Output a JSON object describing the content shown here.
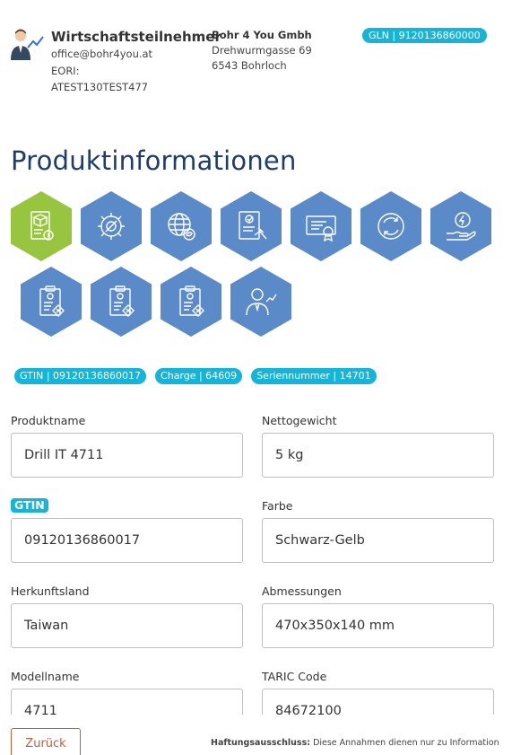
{
  "header": {
    "company_name": "Wirtschaftsteilnehmer",
    "email": "office@bohr4you.at",
    "eori_label": "EORI:",
    "eori_value": "ATEST130TEST477",
    "address_name": "Bohr 4 You Gmbh",
    "address_street": "Drehwurmgasse 69",
    "address_city": "6543 Bohrloch",
    "gln_badge": "GLN | 9120136860000"
  },
  "page_title": "Produktinformationen",
  "category_icons": [
    "product-box-icon",
    "settings-tools-icon",
    "globe-leaf-icon",
    "checklist-gavel-icon",
    "certificate-icon",
    "recycle-icon",
    "hand-energy-icon",
    "clipboard-hazard-icon",
    "clipboard-hazard-icon",
    "clipboard-hazard-icon",
    "person-chart-icon"
  ],
  "badges": [
    "GTIN | 09120136860017",
    "Charge | 64609",
    "Seriennummer | 14701"
  ],
  "form": {
    "produktname_label": "Produktname",
    "produktname_value": "Drill IT 4711",
    "nettogewicht_label": "Nettogewicht",
    "nettogewicht_value": "5 kg",
    "gtin_label": "GTIN",
    "gtin_value": "09120136860017",
    "farbe_label": "Farbe",
    "farbe_value": "Schwarz-Gelb",
    "herkunftsland_label": "Herkunftsland",
    "herkunftsland_value": "Taiwan",
    "abmessungen_label": "Abmessungen",
    "abmessungen_value": "470x350x140 mm",
    "modellname_label": "Modellname",
    "modellname_value": "4711",
    "taric_label": "TARIC Code",
    "taric_value": "84672100"
  },
  "footer": {
    "back_label": "Zurück",
    "disclaimer_label": "Haftungsausschluss:",
    "disclaimer_text": "Diese Annahmen dienen nur zu Information"
  },
  "colors": {
    "accent": "#15b4d9",
    "title": "#1e3d6e",
    "hex_blue": "#5b8ac9",
    "hex_green": "#97c540",
    "back_button": "#c85a3c"
  }
}
